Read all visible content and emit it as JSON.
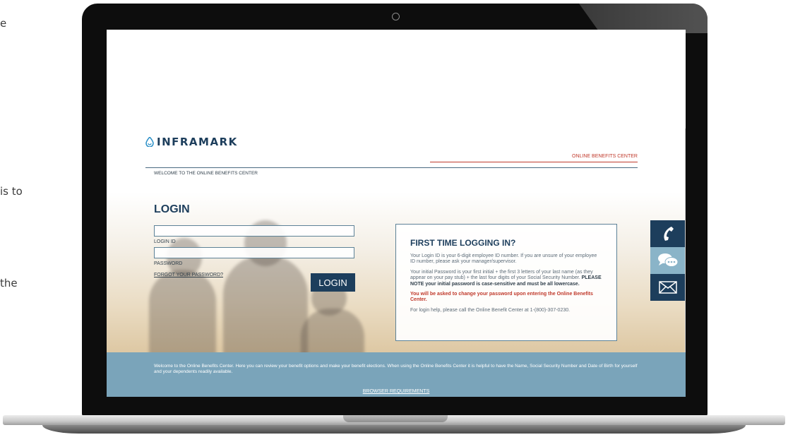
{
  "side_fragments": [
    "e",
    "is to",
    "the"
  ],
  "brand": {
    "name": "INFRAMARK"
  },
  "header": {
    "online_benefits_center": "ONLINE BENEFITS CENTER",
    "welcome": "WELCOME TO THE ONLINE BENEFITS CENTER"
  },
  "login": {
    "title": "LOGIN",
    "login_id_value": "",
    "login_id_label": "LOGIN ID",
    "password_value": "",
    "password_label": "PASSWORD",
    "forgot": "FORGOT YOUR PASSWORD?",
    "button": "LOGIN"
  },
  "first_time": {
    "title": "FIRST TIME LOGGING IN?",
    "p1": "Your Login ID is your 6-digit employee ID number. If you are unsure of your employee ID number, please ask your manager/supervisor.",
    "p2_start": "Your initial Password is your first initial + the first 3 letters of your last name (as they appear on your pay stub) + the last four digits of your Social Security Number. ",
    "p2_bold": "PLEASE NOTE your initial password is case-sensitive and must be all lowercase.",
    "p3": "You will be asked to change your password upon entering the Online Benefits Center.",
    "p4": "For login help, please call the Online Benefit Center at 1-(800)-307-0230."
  },
  "side_buttons": {
    "icons": [
      "phone-icon",
      "chat-icon",
      "mail-icon"
    ]
  },
  "footer": {
    "text": "Welcome to the Online Benefits Center. Here you can review your benefit options and make your benefit elections. When using the Online Benefits Center it is helpful to have the Name, Social Security Number and Date of Birth for yourself and your dependents readily available.",
    "link": "BROWSER REQUIREMENTS"
  },
  "colors": {
    "navy": "#1d3e5c",
    "red": "#c0392b",
    "footer": "#7aa4ba"
  }
}
